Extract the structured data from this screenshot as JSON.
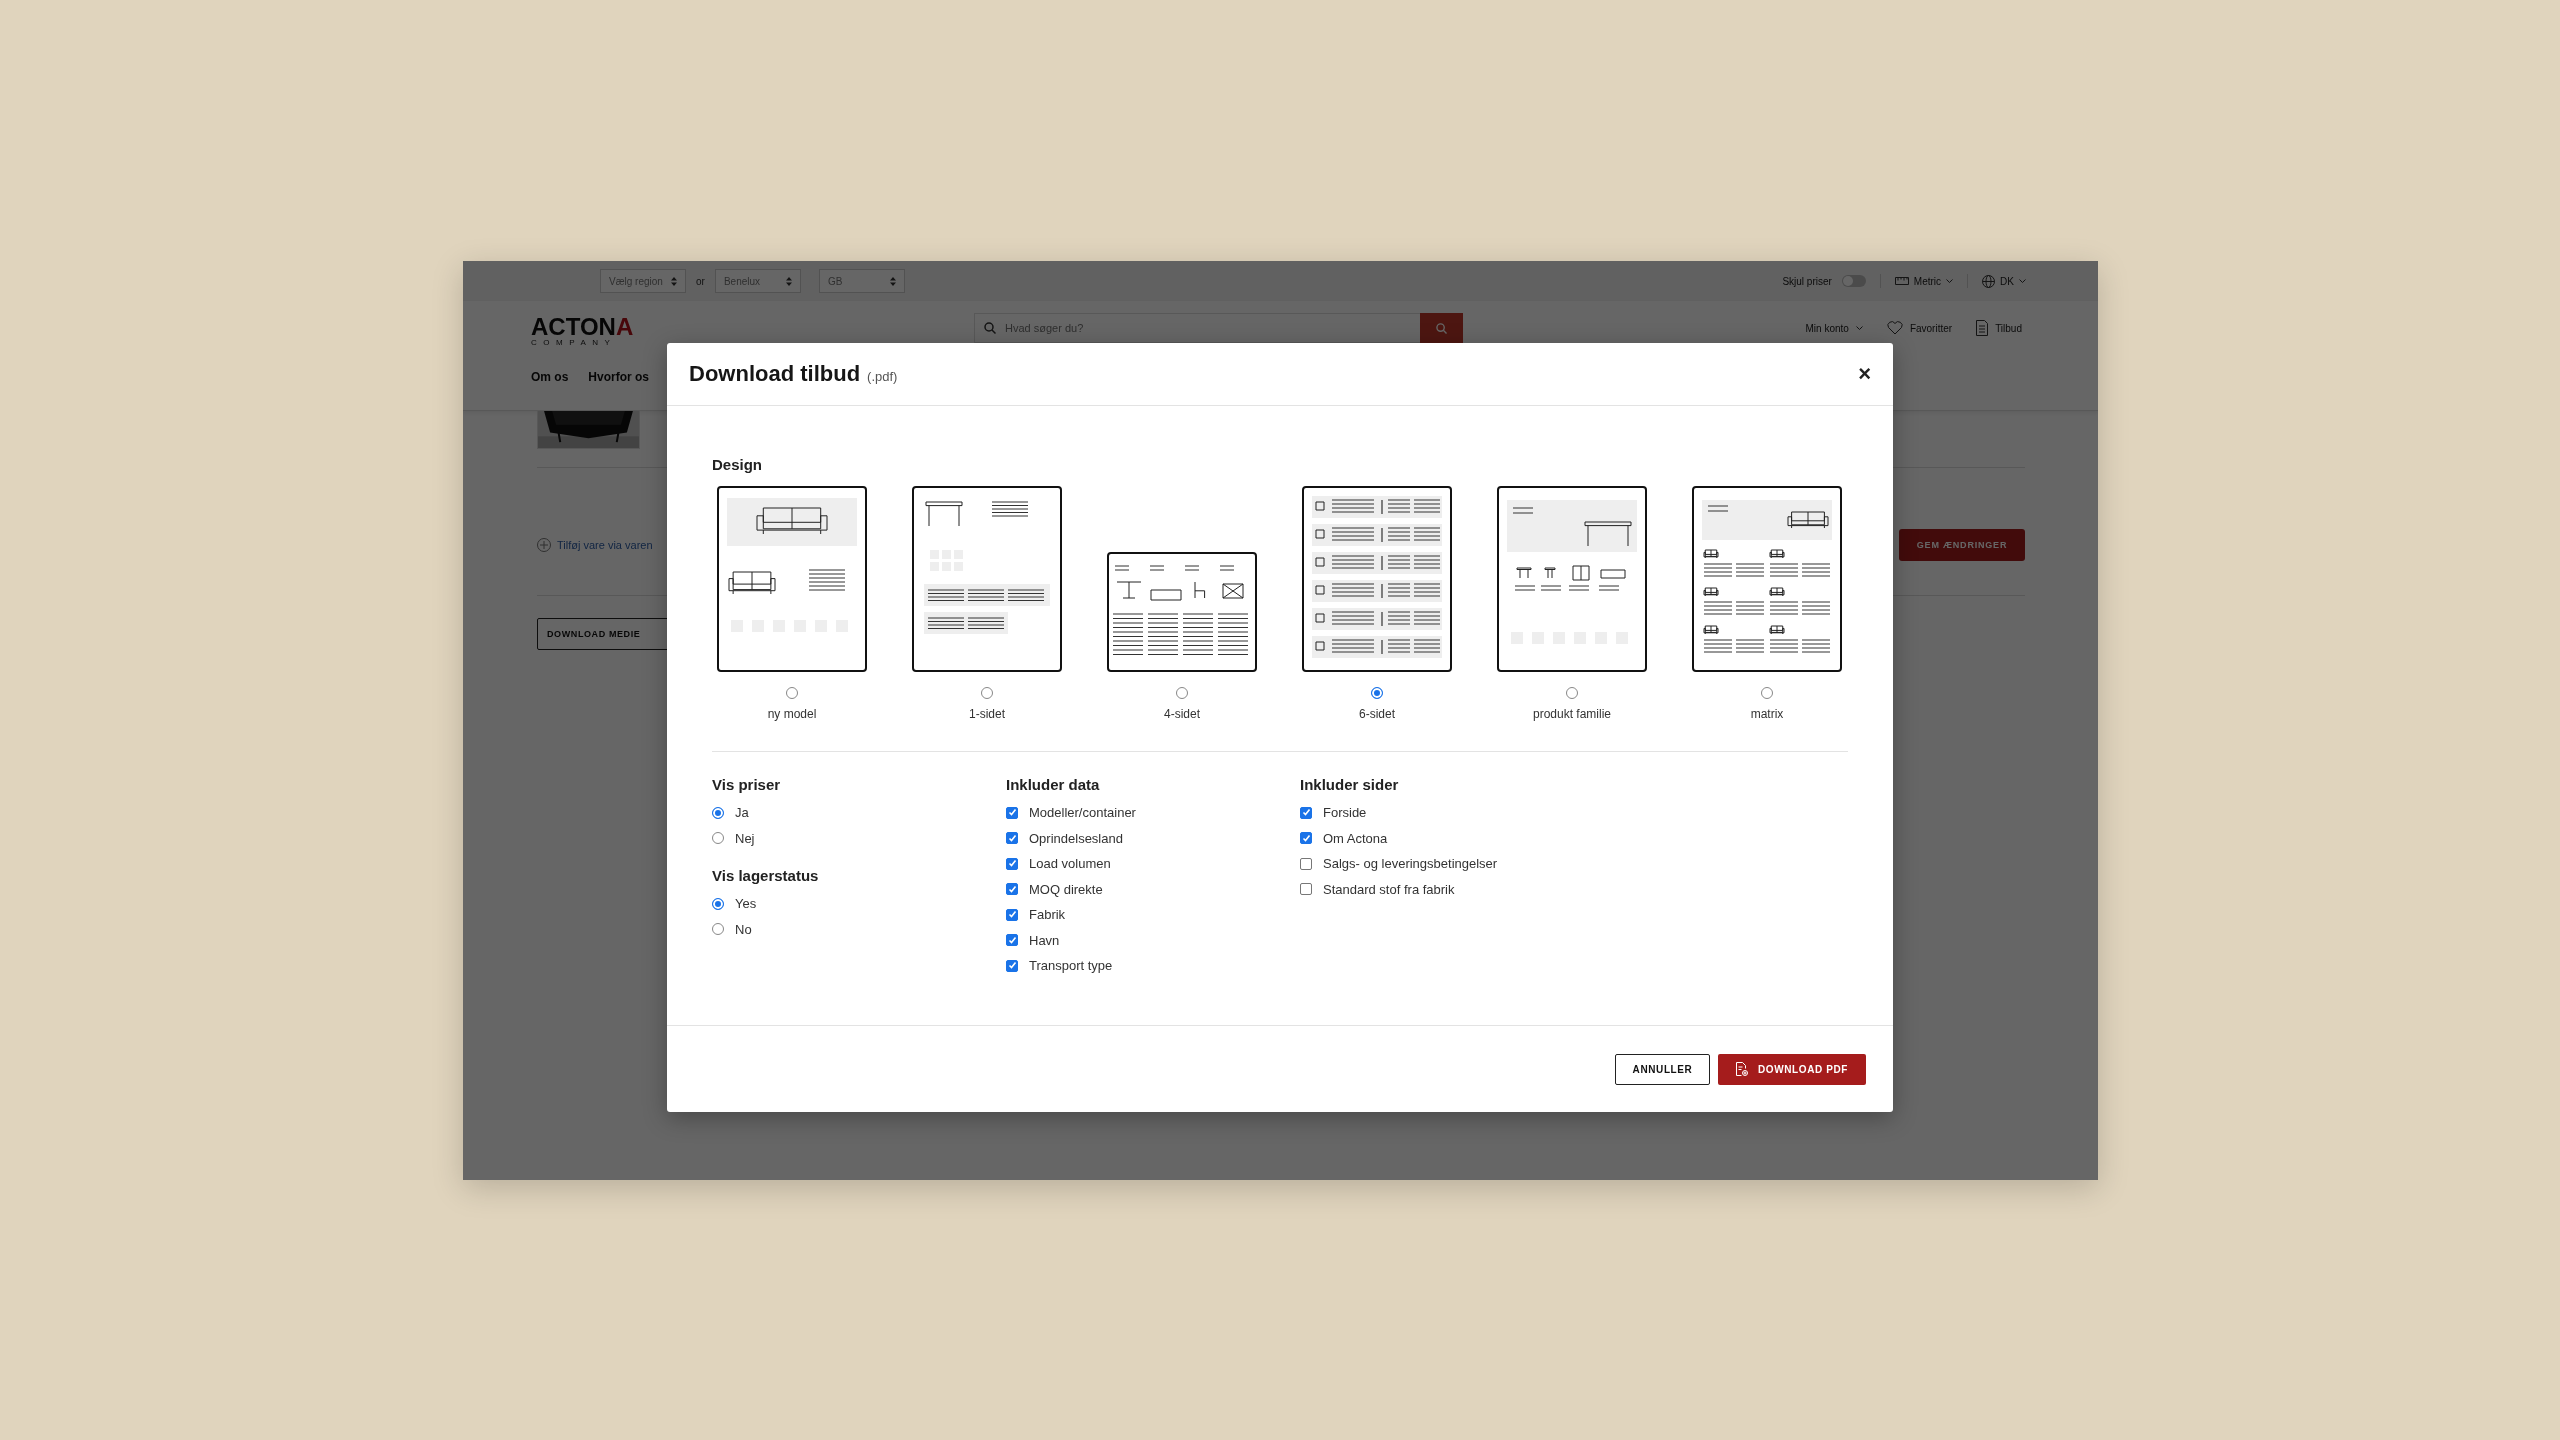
{
  "topbar": {
    "region_select": "Vælg region",
    "separator": "or",
    "market_selects": [
      "Benelux",
      "GB"
    ],
    "price_toggle": {
      "label": "Skjul priser",
      "on": false
    },
    "unit_menu": "Metric",
    "language_menu": "DK"
  },
  "header": {
    "logo": {
      "text": "ACTON",
      "accent": "A",
      "tagline": "COMPANY"
    },
    "search": {
      "placeholder": "Hvad søger du?"
    },
    "links": [
      {
        "label": "Min konto",
        "kind": "menu"
      },
      {
        "label": "Favoritter",
        "kind": "heart"
      },
      {
        "label": "Tilbud",
        "kind": "document"
      }
    ]
  },
  "nav": [
    "Om os",
    "Hvorfor os"
  ],
  "page": {
    "add_item_link": "Tilføj vare via varen",
    "download_media_button": "DOWNLOAD MEDIE",
    "save_button": "GEM ÆNDRINGER"
  },
  "dialog": {
    "title": "Download tilbud",
    "subtitle": "(.pdf)",
    "close": "×",
    "design": {
      "label": "Design",
      "options": [
        {
          "label": "ny model",
          "kind": "model",
          "selected": false
        },
        {
          "label": "1-sidet",
          "kind": "single",
          "selected": false
        },
        {
          "label": "4-sidet",
          "kind": "four",
          "selected": false
        },
        {
          "label": "6-sidet",
          "kind": "six",
          "selected": true
        },
        {
          "label": "produkt familie",
          "kind": "family",
          "selected": false
        },
        {
          "label": "matrix",
          "kind": "matrix",
          "selected": false
        }
      ]
    },
    "columns": [
      [
        {
          "heading": "Vis priser",
          "kind": "radio",
          "items": [
            {
              "label": "Ja",
              "selected": true
            },
            {
              "label": "Nej",
              "selected": false
            }
          ]
        },
        {
          "heading": "Vis lagerstatus",
          "kind": "radio",
          "items": [
            {
              "label": "Yes",
              "selected": true
            },
            {
              "label": "No",
              "selected": false
            }
          ]
        }
      ],
      [
        {
          "heading": "Inkluder data",
          "kind": "checkbox",
          "items": [
            {
              "label": "Modeller/container",
              "checked": true
            },
            {
              "label": "Oprindelsesland",
              "checked": true
            },
            {
              "label": "Load volumen",
              "checked": true
            },
            {
              "label": "MOQ direkte",
              "checked": true
            },
            {
              "label": "Fabrik",
              "checked": true
            },
            {
              "label": "Havn",
              "checked": true
            },
            {
              "label": "Transport type",
              "checked": true
            }
          ]
        }
      ],
      [
        {
          "heading": "Inkluder sider",
          "kind": "checkbox",
          "items": [
            {
              "label": "Forside",
              "checked": true
            },
            {
              "label": "Om Actona",
              "checked": true
            },
            {
              "label": "Salgs- og leveringsbetingelser",
              "checked": false
            },
            {
              "label": "Standard stof fra fabrik",
              "checked": false
            }
          ]
        }
      ]
    ],
    "buttons": {
      "cancel": "ANNULLER",
      "download": "DOWNLOAD PDF"
    }
  }
}
